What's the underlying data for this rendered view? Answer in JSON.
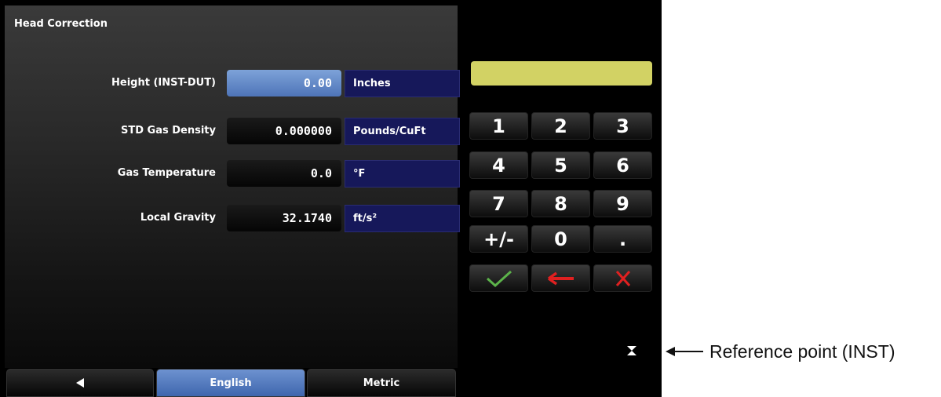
{
  "screen": {
    "title": "Head Correction",
    "rows": [
      {
        "label": "Height (INST-DUT)",
        "value": "0.00",
        "unit": "Inches"
      },
      {
        "label": "STD Gas Density",
        "value": "0.000000",
        "unit": "Pounds/CuFt"
      },
      {
        "label": "Gas Temperature",
        "value": "0.0",
        "unit": "°F"
      },
      {
        "label": "Local Gravity",
        "value": "32.1740",
        "unit": "ft/s²"
      }
    ],
    "selected_row": "Height (INST-DUT)",
    "keypad": {
      "keys": [
        "1",
        "2",
        "3",
        "4",
        "5",
        "6",
        "7",
        "8",
        "9",
        "+/-",
        "0",
        "."
      ],
      "accept_icon": "checkmark-icon",
      "backspace_icon": "left-arrow-icon",
      "cancel_icon": "x-icon"
    },
    "colors": {
      "selected_value": "#5b7fc0",
      "unit_background": "#16185a",
      "display_bar": "#d2d264",
      "accept": "#5cb34a",
      "backspace": "#e02020",
      "cancel": "#e02020"
    },
    "bottom_bar": {
      "back_icon": "triangle-left-icon",
      "tabs": [
        "English",
        "Metric"
      ],
      "active_tab": "English"
    }
  },
  "annotation": {
    "marker_icon": "hourglass-reference-icon",
    "text": "Reference point (INST)"
  }
}
